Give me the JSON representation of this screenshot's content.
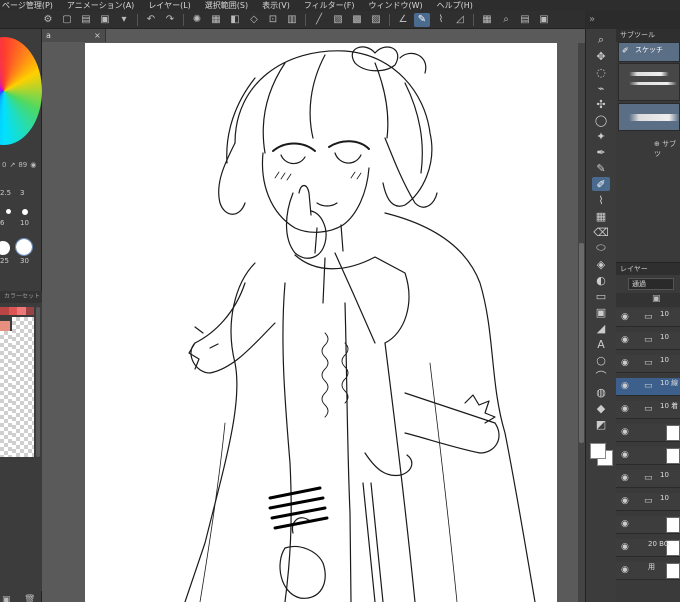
{
  "menu": [
    "ページ管理(P)",
    "アニメーション(A)",
    "レイヤー(L)",
    "選択範囲(S)",
    "表示(V)",
    "フィルター(F)",
    "ウィンドウ(W)",
    "ヘルプ(H)"
  ],
  "right_top_label": "»",
  "canvas": {
    "tab_label": "a",
    "tab_close": "×"
  },
  "left_panel": {
    "color_values": [
      "0",
      "89"
    ],
    "brush_sizes": [
      "2.5",
      "3",
      "6",
      "10",
      "25",
      "30"
    ],
    "swatch_label": "カラーセット"
  },
  "subtool": {
    "tab_label": "サブツール",
    "items": [
      {
        "label": "スケッチ"
      }
    ],
    "add_label": "サブツ"
  },
  "layers": {
    "tab_label": "レイヤー",
    "blend_mode": "通過",
    "rows": [
      {
        "name": "10",
        "visible": true,
        "folder": true,
        "selected": false
      },
      {
        "name": "10",
        "visible": true,
        "folder": true,
        "selected": false
      },
      {
        "name": "10",
        "visible": true,
        "folder": true,
        "selected": false
      },
      {
        "name": "10 線",
        "visible": true,
        "folder": true,
        "selected": true
      },
      {
        "name": "10 着",
        "visible": true,
        "folder": true,
        "selected": false
      },
      {
        "name": "",
        "visible": true,
        "folder": false,
        "selected": false
      },
      {
        "name": "",
        "visible": true,
        "folder": false,
        "selected": false
      },
      {
        "name": "10",
        "visible": true,
        "folder": true,
        "selected": false
      },
      {
        "name": "10",
        "visible": true,
        "folder": true,
        "selected": false
      },
      {
        "name": "",
        "visible": true,
        "folder": false,
        "selected": false
      },
      {
        "name": "20 BG",
        "visible": true,
        "folder": false,
        "selected": false
      },
      {
        "name": "用",
        "visible": true,
        "folder": false,
        "selected": false
      }
    ]
  },
  "colors": {
    "accent": "#4a6b8e",
    "selected_layer": "#3c5f8b"
  }
}
